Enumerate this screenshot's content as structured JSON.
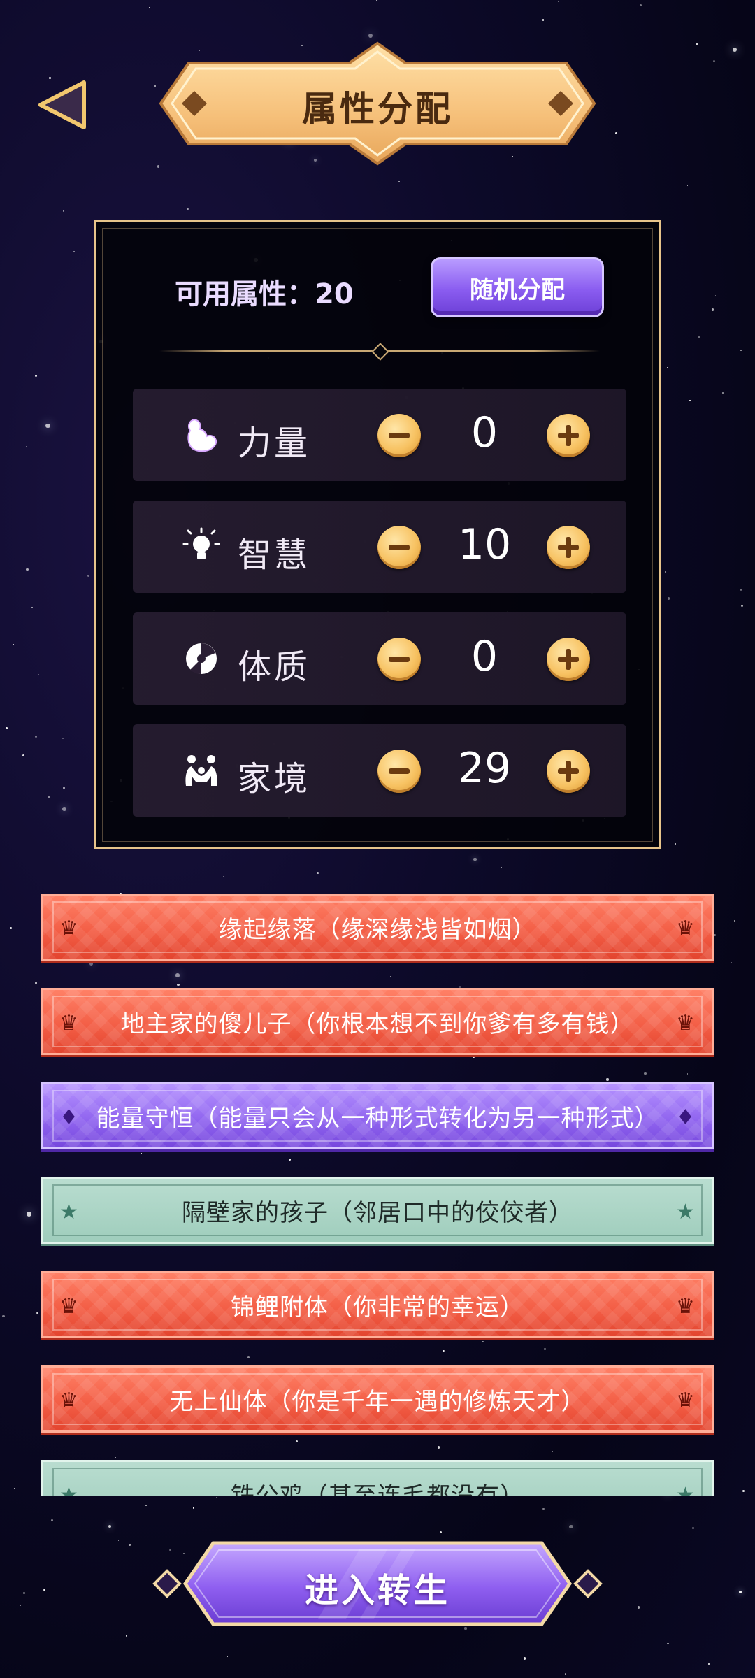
{
  "header": {
    "title": "属性分配",
    "back_icon": "back-arrow-icon"
  },
  "panel": {
    "available_label": "可用属性：20",
    "random_button": "随机分配",
    "stats": [
      {
        "name": "力量",
        "icon": "muscle-icon",
        "value": "0"
      },
      {
        "name": "智慧",
        "icon": "lightbulb-icon",
        "value": "10"
      },
      {
        "name": "体质",
        "icon": "constitution-icon",
        "value": "0"
      },
      {
        "name": "家境",
        "icon": "family-icon",
        "value": "29"
      }
    ]
  },
  "talents": [
    {
      "label": "缘起缘落（缘深缘浅皆如烟）",
      "rarity": "red",
      "icon": "crown-icon"
    },
    {
      "label": "地主家的傻儿子（你根本想不到你爹有多有钱）",
      "rarity": "red",
      "icon": "crown-icon"
    },
    {
      "label": "能量守恒（能量只会从一种形式转化为另一种形式）",
      "rarity": "purple",
      "icon": "diamond-icon"
    },
    {
      "label": "隔壁家的孩子（邻居口中的佼佼者）",
      "rarity": "green",
      "icon": "star-icon"
    },
    {
      "label": "锦鲤附体（你非常的幸运）",
      "rarity": "red",
      "icon": "crown-icon"
    },
    {
      "label": "无上仙体（你是千年一遇的修炼天才）",
      "rarity": "red",
      "icon": "crown-icon"
    },
    {
      "label": "铁公鸡（甚至连毛都没有）",
      "rarity": "green",
      "icon": "star-icon"
    }
  ],
  "footer": {
    "enter_button": "进入转生"
  },
  "colors": {
    "gold": "#f7c262",
    "red_talent": "#f25c44",
    "purple_talent": "#8e62ee",
    "green_talent": "#9fcdbc"
  }
}
